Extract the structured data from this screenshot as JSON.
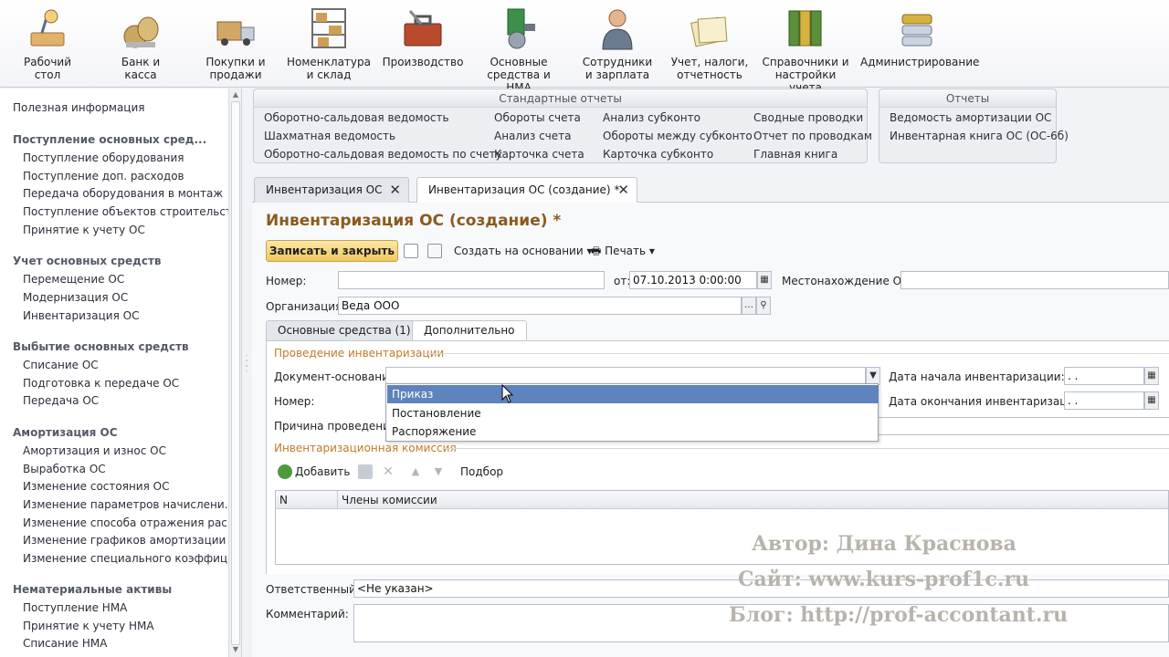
{
  "sections": [
    {
      "label": "Рабочий\nстол",
      "icon": "desk-lamp-icon"
    },
    {
      "label": "Банк и\nкасса",
      "icon": "money-bags-icon"
    },
    {
      "label": "Покупки и\nпродажи",
      "icon": "truck-boxes-icon"
    },
    {
      "label": "Номенклатура\nи склад",
      "icon": "warehouse-shelves-icon"
    },
    {
      "label": "Производство",
      "icon": "toolbox-icon"
    },
    {
      "label": "Основные\nсредства и НМА",
      "icon": "machine-equipment-icon"
    },
    {
      "label": "Сотрудники\nи зарплата",
      "icon": "employee-icon"
    },
    {
      "label": "Учет, налоги,\nотчетность",
      "icon": "documents-icon"
    },
    {
      "label": "Справочники и\nнастройки учета",
      "icon": "binders-icon"
    },
    {
      "label": "Администрирование",
      "icon": "server-icon"
    }
  ],
  "left_panel": {
    "useful_info": "Полезная информация",
    "groups": [
      {
        "title": "Поступление основных сред...",
        "items": [
          "Поступление оборудования",
          "Поступление доп. расходов",
          "Передача оборудования в монтаж",
          "Поступление объектов строительст...",
          "Принятие к учету ОС"
        ]
      },
      {
        "title": "Учет основных средств",
        "items": [
          "Перемещение ОС",
          "Модернизация ОС",
          "Инвентаризация ОС"
        ]
      },
      {
        "title": "Выбытие основных средств",
        "items": [
          "Списание ОС",
          "Подготовка к передаче ОС",
          "Передача ОС"
        ]
      },
      {
        "title": "Амортизация ОС",
        "items": [
          "Амортизация и износ ОС",
          "Выработка ОС",
          "Изменение состояния ОС",
          "Изменение параметров начислени...",
          "Изменение способа отражения рас...",
          "Изменение графиков амортизации ...",
          "Изменение специального коэффиц..."
        ]
      },
      {
        "title": "Нематериальные активы",
        "items": [
          "Поступление НМА",
          "Принятие к учету НМА",
          "Списание НМА"
        ]
      }
    ]
  },
  "standard_reports": {
    "caption": "Стандартные отчеты",
    "col1": [
      "Оборотно-сальдовая ведомость",
      "Шахматная ведомость",
      "Оборотно-сальдовая ведомость по счету"
    ],
    "col2": [
      "Обороты счета",
      "Анализ счета",
      "Карточка счета"
    ],
    "col3": [
      "Анализ субконто",
      "Обороты между субконто",
      "Карточка субконто"
    ],
    "col4": [
      "Сводные проводки",
      "Отчет по проводкам",
      "Главная книга"
    ]
  },
  "reports": {
    "caption": "Отчеты",
    "items": [
      "Ведомость амортизации ОС",
      "Инвентарная книга ОС (ОС-6б)"
    ]
  },
  "tabs": [
    {
      "label": "Инвентаризация ОС"
    },
    {
      "label": "Инвентаризация ОС (создание) *"
    }
  ],
  "form": {
    "title": "Инвентаризация ОС (создание) *",
    "toolbar": {
      "save_close": "Записать и закрыть",
      "create_based": "Создать на основании",
      "print": "Печать"
    },
    "number_label": "Номер:",
    "number_value": "",
    "date_label": "от:",
    "date_value": "07.10.2013  0:00:00",
    "location_label": "Местонахождение ОС:",
    "location_value": "",
    "org_label": "Организация:",
    "org_value": "Веда ООО",
    "subtabs": [
      "Основные средства (1)",
      "Дополнительно"
    ],
    "inventory_group": "Проведение инвентаризации",
    "doc_basis_label": "Документ-основание:",
    "doc_basis_value": "",
    "number2_label": "Номер:",
    "reason_label": "Причина проведения:",
    "start_date_label": "Дата начала инвентаризации:",
    "start_date_value": " .  .",
    "end_date_label": "Дата окончания инвентаризации:",
    "end_date_value": " .  .",
    "dropdown_options": [
      "Приказ",
      "Постановление",
      "Распоряжение"
    ],
    "commission_group": "Инвентаризационная комиссия",
    "add_label": "Добавить",
    "pick_label": "Подбор",
    "grid_columns": [
      "N",
      "Члены комиссии"
    ],
    "responsible_label": "Ответственный:",
    "responsible_value": "<Не указан>",
    "comment_label": "Комментарий:",
    "comment_value": ""
  },
  "watermark": {
    "author": "Автор: Дина Краснова",
    "site": "Сайт: www.kurs-prof1c.ru",
    "blog": "Блог: http://prof-accontant.ru"
  }
}
